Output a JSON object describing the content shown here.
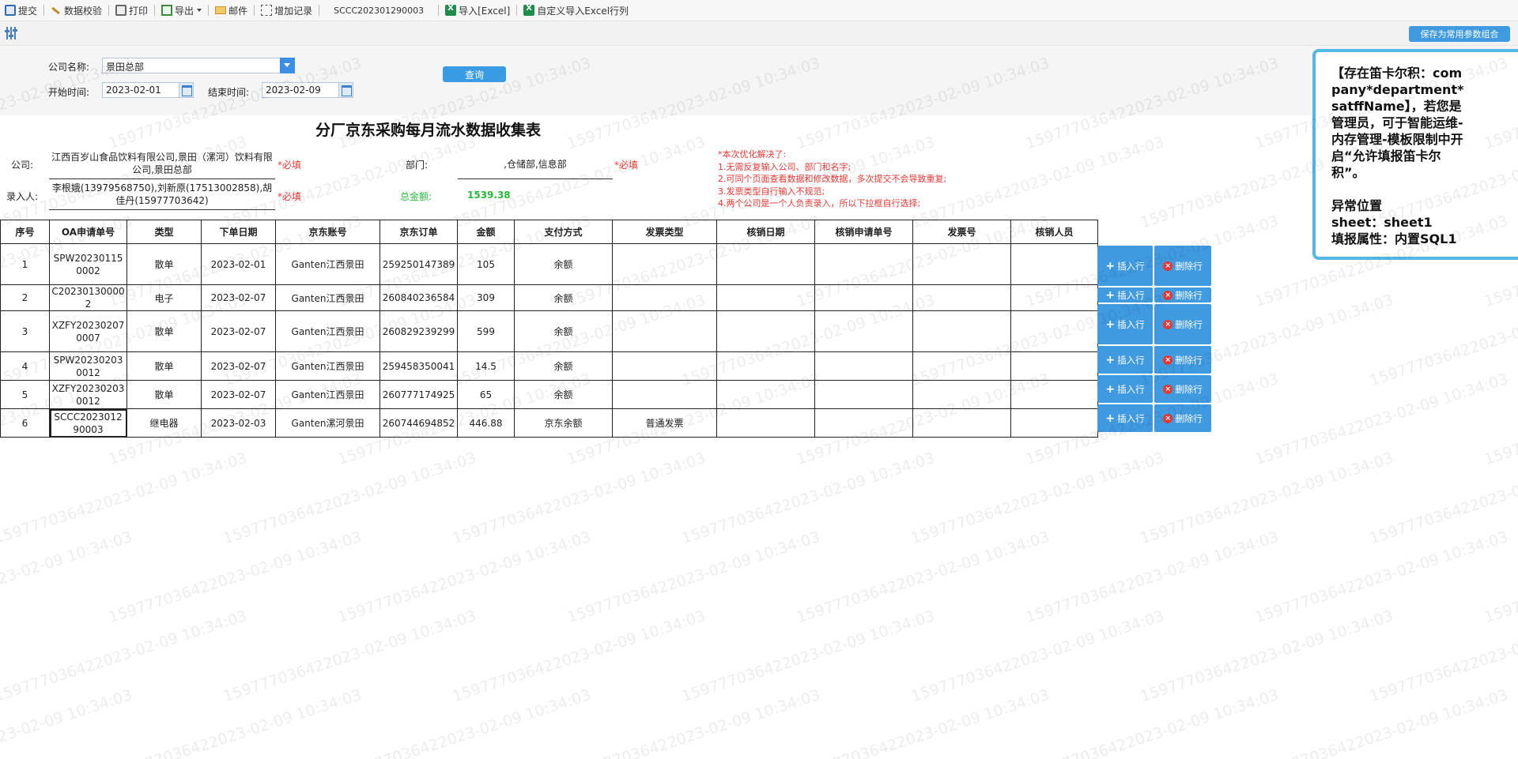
{
  "toolbar": {
    "submit": "提交",
    "validate": "数据校验",
    "print": "打印",
    "export": "导出",
    "email": "邮件",
    "add_record": "增加记录",
    "doc_id": "SCCC202301290003",
    "import_excel": "导入[Excel]",
    "custom_import": "自定义导入Excel行列"
  },
  "parambar": {
    "save_combo": "保存为常用参数组合"
  },
  "query": {
    "company_label": "公司名称:",
    "company_value": "景田总部",
    "start_label": "开始时间:",
    "start_value": "2023-02-01",
    "end_label": "结束时间:",
    "end_value": "2023-02-09",
    "query_button": "查询"
  },
  "form": {
    "title": "分厂京东采购每月流水数据收集表",
    "company_label": "公司:",
    "company_value": "江西百岁山食品饮料有限公司,景田（漯河）饮料有限公司,景田总部",
    "department_label": "部门:",
    "department_value": ",仓储部,信息部",
    "entered_by_label": "录入人:",
    "entered_by_value": "李根娥(13979568750),刘新原(17513002858),胡佳丹(15977703642)",
    "required": "*必填",
    "total_label": "总金额:",
    "total_value": "1539.38",
    "notes": [
      "*本次优化解决了:",
      "1.无需反复输入公司、部门和名字;",
      "2.可同个页面查看数据和修改数据，多次提交不会导致重复;",
      "3.发票类型自行输入不规范;",
      "4.两个公司是一个人负责录入，所以下拉框自行选择;"
    ]
  },
  "table": {
    "headers": [
      "序号",
      "OA申请单号",
      "类型",
      "下单日期",
      "京东账号",
      "京东订单",
      "金额",
      "支付方式",
      "发票类型",
      "核销日期",
      "核销申请单号",
      "发票号",
      "核销人员"
    ],
    "rows": [
      [
        "1",
        "SPW202301150002",
        "散单",
        "2023-02-01",
        "Ganten江西景田",
        "259250147389",
        "105",
        "余额",
        "",
        "",
        "",
        "",
        ""
      ],
      [
        "2",
        "C202301300002",
        "电子",
        "2023-02-07",
        "Ganten江西景田",
        "260840236584",
        "309",
        "余额",
        "",
        "",
        "",
        "",
        ""
      ],
      [
        "3",
        "XZFY202302070007",
        "散单",
        "2023-02-07",
        "Ganten江西景田",
        "260829239299",
        "599",
        "余额",
        "",
        "",
        "",
        "",
        ""
      ],
      [
        "4",
        "SPW202302030012",
        "散单",
        "2023-02-07",
        "Ganten江西景田",
        "259458350041",
        "14.5",
        "余额",
        "",
        "",
        "",
        "",
        ""
      ],
      [
        "5",
        "XZFY202302030012",
        "散单",
        "2023-02-07",
        "Ganten江西景田",
        "260777174925",
        "65",
        "余额",
        "",
        "",
        "",
        "",
        ""
      ],
      [
        "6",
        "SCCC202301290003",
        "继电器",
        "2023-02-03",
        "Ganten漯河景田",
        "260744694852",
        "446.88",
        "京东余额",
        "普通发票",
        "",
        "",
        "",
        ""
      ]
    ],
    "insert_label": "插入行",
    "delete_label": "删除行"
  },
  "tip": {
    "text": "【存在笛卡尔积：company*department*satffName】，若您是管理员，可于智能运维-内存管理-模板限制中开启“允许填报笛卡尔积”。\n\n异常位置\nsheet：sheet1\n填报属性：内置SQL1"
  },
  "watermark": "159777036422023-02-09 10:34:03",
  "colors": {
    "accent": "#3f9ae0",
    "required": "#e53935",
    "total": "#27b83b",
    "tip_border": "#55b7e6"
  }
}
